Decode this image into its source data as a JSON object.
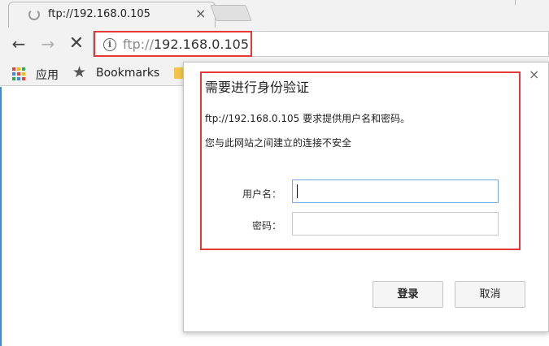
{
  "tab": {
    "title": "ftp://192.168.0.105",
    "close_glyph": "×",
    "spinner_icon": "loading-spinner-icon"
  },
  "toolbar": {
    "back_glyph": "←",
    "forward_glyph": "→",
    "stop_glyph": "✕",
    "info_glyph": "i",
    "url_scheme": "ftp://",
    "url_host": "192.168.0.105"
  },
  "bookmarks_bar": {
    "apps_label": "应用",
    "star_glyph": "★",
    "bookmarks_label": "Bookmarks",
    "apps_colors": [
      "#ea4335",
      "#fbbc05",
      "#34a853",
      "#4285f4",
      "#ea4335",
      "#fbbc05",
      "#34a853",
      "#4285f4",
      "#ea4335"
    ]
  },
  "dialog": {
    "close_glyph": "×",
    "title": "需要进行身份验证",
    "message": "ftp://192.168.0.105 要求提供用户名和密码。",
    "warning": "您与此网站之间建立的连接不安全",
    "username_label": "用户名：",
    "password_label": "密码：",
    "username_value": "",
    "password_value": "",
    "login_button": "登录",
    "cancel_button": "取消"
  },
  "colors": {
    "highlight_red": "#e53935",
    "focus_blue": "#7ba7e1"
  }
}
